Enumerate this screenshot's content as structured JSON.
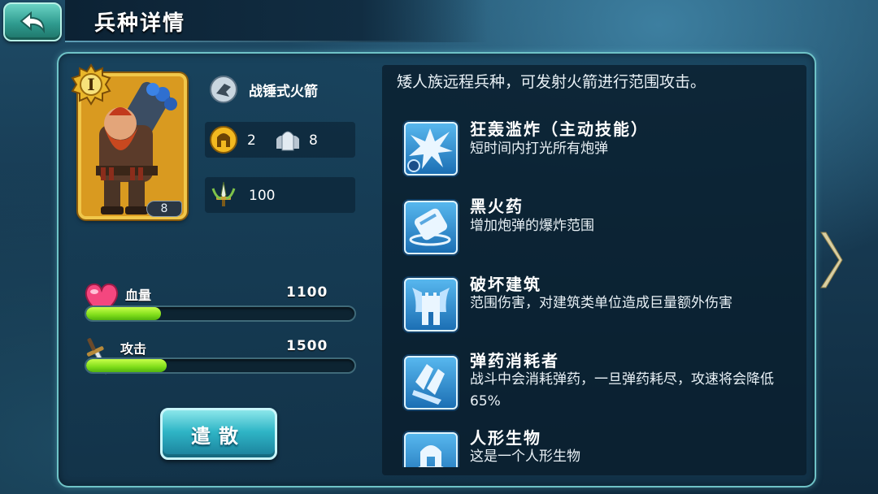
{
  "header": {
    "title": "兵种详情"
  },
  "unit": {
    "card_level": "I",
    "count": "8",
    "name": "战锤式火箭",
    "cost_value": "2",
    "population_value": "8",
    "power_value": "100"
  },
  "stats": {
    "hp": {
      "label": "血量",
      "value": "1100",
      "fill": 0.28
    },
    "attack": {
      "label": "攻击",
      "value": "1500",
      "fill": 0.3
    }
  },
  "actions": {
    "dismiss_label": "遣散"
  },
  "description": "矮人族远程兵种，可发射火箭进行范围攻击。",
  "skills": [
    {
      "icon": "explosion-icon",
      "name": "狂轰滥炸（主动技能）",
      "desc": "短时间内打光所有炮弹"
    },
    {
      "icon": "powder-keg-icon",
      "name": "黑火药",
      "desc": "增加炮弹的爆炸范围"
    },
    {
      "icon": "tower-icon",
      "name": "破坏建筑",
      "desc": "范围伤害，对建筑类单位造成巨量额外伤害"
    },
    {
      "icon": "ammo-icon",
      "name": "弹药消耗者",
      "desc": "战斗中会消耗弹药，一旦弹药耗尽，攻速将会降低65%"
    },
    {
      "icon": "humanoid-helmet-icon",
      "name": "人形生物",
      "desc": "这是一个人形生物"
    }
  ],
  "colors": {
    "accent": "#6fc3c7",
    "bar_fill": "#7fdd1a",
    "card_gold": "#f1c74a"
  }
}
